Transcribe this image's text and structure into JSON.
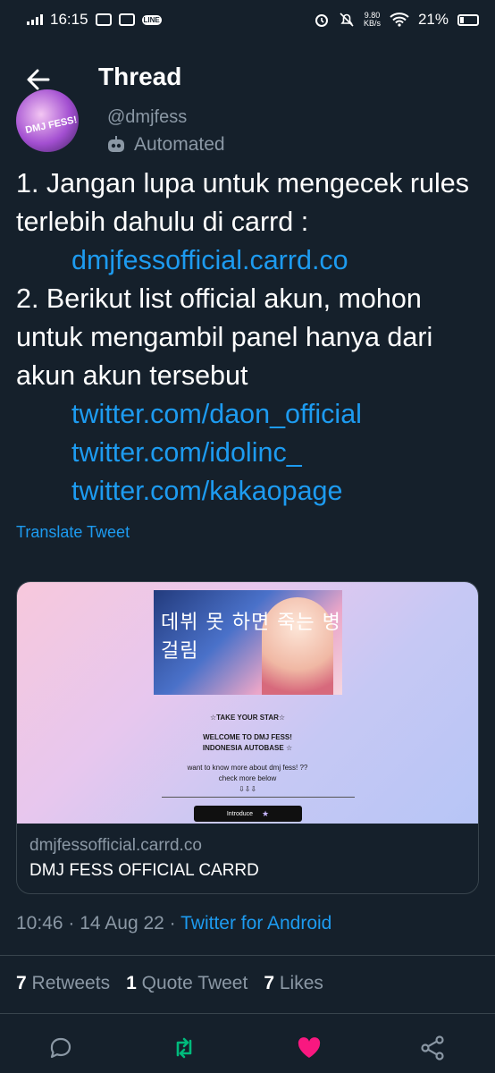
{
  "status_bar": {
    "time": "16:15",
    "speed_value": "9.80",
    "speed_unit": "KB/s",
    "battery": "21%",
    "line_badge": "LINE"
  },
  "header": {
    "title": "Thread"
  },
  "author": {
    "avatar_text": "DMJ FESS!",
    "handle": "@dmjfess",
    "label": "Automated"
  },
  "tweet": {
    "line1": "1. Jangan lupa untuk mengecek rules terlebih dahulu di carrd :",
    "link1": "dmjfessofficial.carrd.co",
    "line2": "2. Berikut list official akun, mohon untuk mengambil panel hanya dari akun akun tersebut",
    "link2": "twitter.com/daon_official",
    "link3": "twitter.com/idolinc_",
    "link4": "twitter.com/kakaopage",
    "translate": "Translate Tweet"
  },
  "card": {
    "cover_title": "데뷔 못 하면 죽는 병 걸림",
    "take_star": "☆TAKE YOUR STAR☆",
    "welcome": "WELCOME TO DMJ FESS!",
    "autobase": "INDONESIA AUTOBASE ☆",
    "want_more": "want to know more about dmj fess! ??",
    "check_more": "check more below",
    "arrows": "⇩⇩⇩",
    "button_label": "Introduce",
    "domain": "dmjfessofficial.carrd.co",
    "title": "DMJ FESS OFFICIAL CARRD"
  },
  "meta": {
    "time": "10:46",
    "date": "14 Aug 22",
    "source": "Twitter for Android",
    "separator": " · "
  },
  "stats": {
    "retweets_count": "7",
    "retweets_label": "Retweets",
    "quotes_count": "1",
    "quotes_label": "Quote Tweet",
    "likes_count": "7",
    "likes_label": "Likes"
  },
  "colors": {
    "background": "#15202b",
    "accent": "#1d9bf0",
    "muted": "#8b98a5",
    "retweet_green": "#00ba7c",
    "like_pink": "#f91880"
  }
}
